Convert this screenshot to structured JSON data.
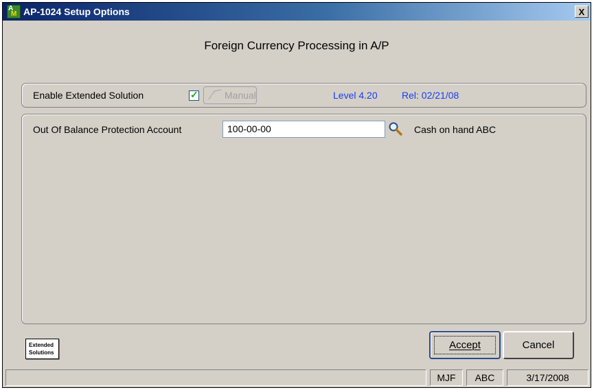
{
  "window": {
    "title": "AP-1024  Setup Options",
    "close_label": "X"
  },
  "heading": "Foreign Currency Processing in A/P",
  "options": {
    "enable_label": "Enable Extended Solution",
    "enable_checked": true,
    "check_glyph": "✓",
    "manual_label": "Manual",
    "level": "Level 4.20",
    "release": "Rel: 02/21/08"
  },
  "account": {
    "label": "Out Of Balance Protection Account",
    "value": "100-00-00",
    "description": "Cash on hand ABC"
  },
  "logo": {
    "line1": "Extended",
    "line2": "Solutions"
  },
  "buttons": {
    "accept": "Accept",
    "cancel": "Cancel"
  },
  "status": {
    "user": "MJF",
    "company": "ABC",
    "date": "3/17/2008"
  },
  "icons": {
    "app": "app-icon",
    "lookup": "magnifier-icon",
    "manual": "manual-icon"
  },
  "colors": {
    "face": "#d4d0c8",
    "title_start": "#0a246a",
    "title_end": "#a6caf0",
    "link_blue": "#1a3cf0",
    "check_green": "#21a121"
  }
}
